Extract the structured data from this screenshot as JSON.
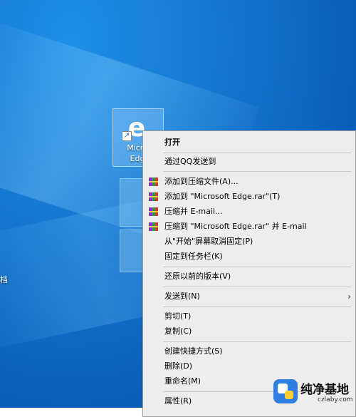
{
  "desktop": {
    "shortcut": {
      "label_line1": "Micro",
      "label_line2": "Edg",
      "icon": "microsoft-edge-icon"
    },
    "side_label": "档"
  },
  "context_menu": {
    "items": [
      {
        "label": "打开",
        "bold": true
      },
      {
        "label": "通过QQ发送到"
      },
      {
        "label": "添加到压缩文件(A)...",
        "icon": "winrar-icon"
      },
      {
        "label": "添加到 \"Microsoft Edge.rar\"(T)",
        "icon": "winrar-icon"
      },
      {
        "label": "压缩并 E-mail...",
        "icon": "winrar-icon"
      },
      {
        "label": "压缩到 \"Microsoft Edge.rar\" 并 E-mail",
        "icon": "winrar-icon"
      },
      {
        "label": "从\"开始\"屏幕取消固定(P)"
      },
      {
        "label": "固定到任务栏(K)"
      },
      {
        "label": "还原以前的版本(V)"
      },
      {
        "label": "发送到(N)",
        "submenu": true
      },
      {
        "label": "剪切(T)"
      },
      {
        "label": "复制(C)"
      },
      {
        "label": "创建快捷方式(S)"
      },
      {
        "label": "删除(D)"
      },
      {
        "label": "重命名(M)"
      },
      {
        "label": "属性(R)"
      }
    ],
    "submenu_arrow": "›"
  },
  "watermark": {
    "title": "纯净基地",
    "url": "czlaby.com"
  }
}
